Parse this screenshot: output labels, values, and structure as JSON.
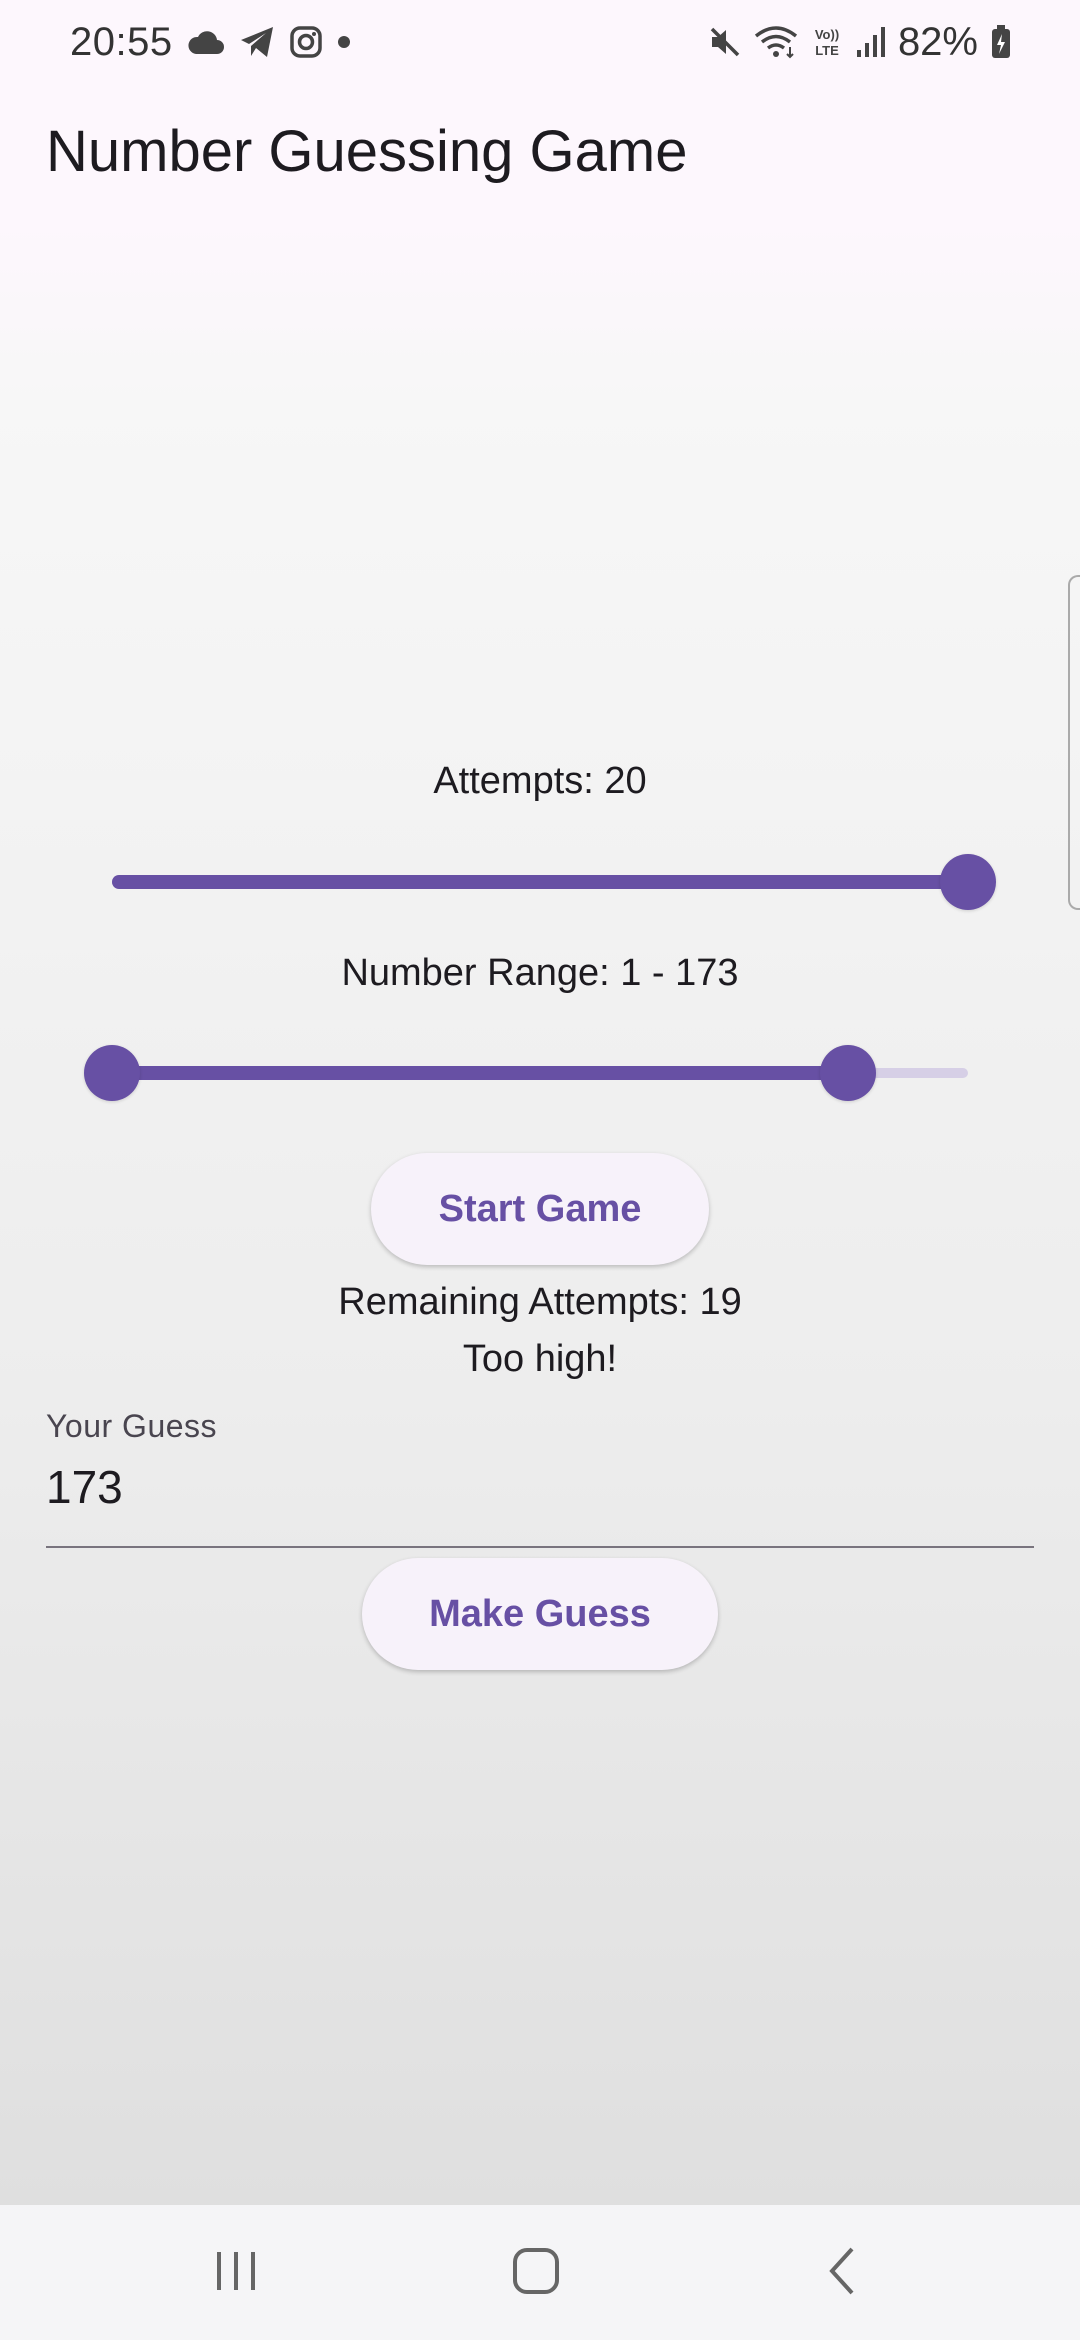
{
  "status_bar": {
    "time": "20:55",
    "battery": "82%",
    "left_icons": [
      "cloud-icon",
      "telegram-icon",
      "instagram-icon",
      "dot-icon"
    ],
    "right_icons": [
      "mute-icon",
      "wifi-icon",
      "volte-icon",
      "signal-icon",
      "battery-icon"
    ]
  },
  "app": {
    "title": "Number Guessing Game"
  },
  "attempts": {
    "label": "Attempts: 20",
    "fraction": 1.0
  },
  "range": {
    "label": "Number Range: 1 - 173",
    "start_fraction": 0.0,
    "end_fraction": 0.86
  },
  "start_button": {
    "label": "Start Game"
  },
  "status": {
    "remaining": "Remaining Attempts: 19",
    "feedback": "Too high!"
  },
  "guess_field": {
    "label": "Your Guess",
    "value": "173"
  },
  "guess_button": {
    "label": "Make Guess"
  },
  "nav": {
    "icons": [
      "recent-apps-icon",
      "home-icon",
      "back-icon"
    ]
  },
  "colors": {
    "accent": "#6750a4",
    "inactive_track": "#d6cfe6",
    "button_bg": "#f7f2fa"
  }
}
